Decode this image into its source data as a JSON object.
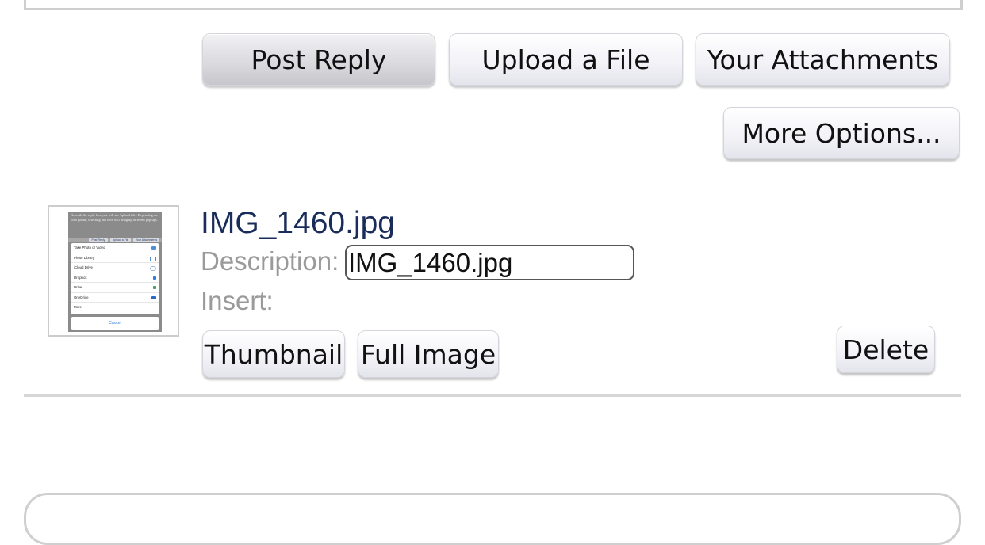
{
  "actions": {
    "post_reply": "Post Reply",
    "upload_file": "Upload a File",
    "your_attachments": "Your Attachments",
    "more_options": "More Options..."
  },
  "attachment": {
    "file_name": "IMG_1460.jpg",
    "description_label": "Description:",
    "description_value": "IMG_1460.jpg",
    "insert_label": "Insert:",
    "thumbnail_button": "Thumbnail",
    "full_image_button": "Full Image",
    "delete_button": "Delete"
  },
  "thumbnail_preview": {
    "intro_text": "Beneath the reply box you will see 'upload file'. Depending on your phone, selecting this icon will bring up different pop ups.",
    "tabs": [
      "Post Reply",
      "Upload a File",
      "Your Attachments"
    ],
    "sheet_items": [
      "Take Photo or Video",
      "Photo Library",
      "iCloud Drive",
      "Dropbox",
      "Drive",
      "OneDrive",
      "More"
    ],
    "cancel": "Cancel"
  }
}
